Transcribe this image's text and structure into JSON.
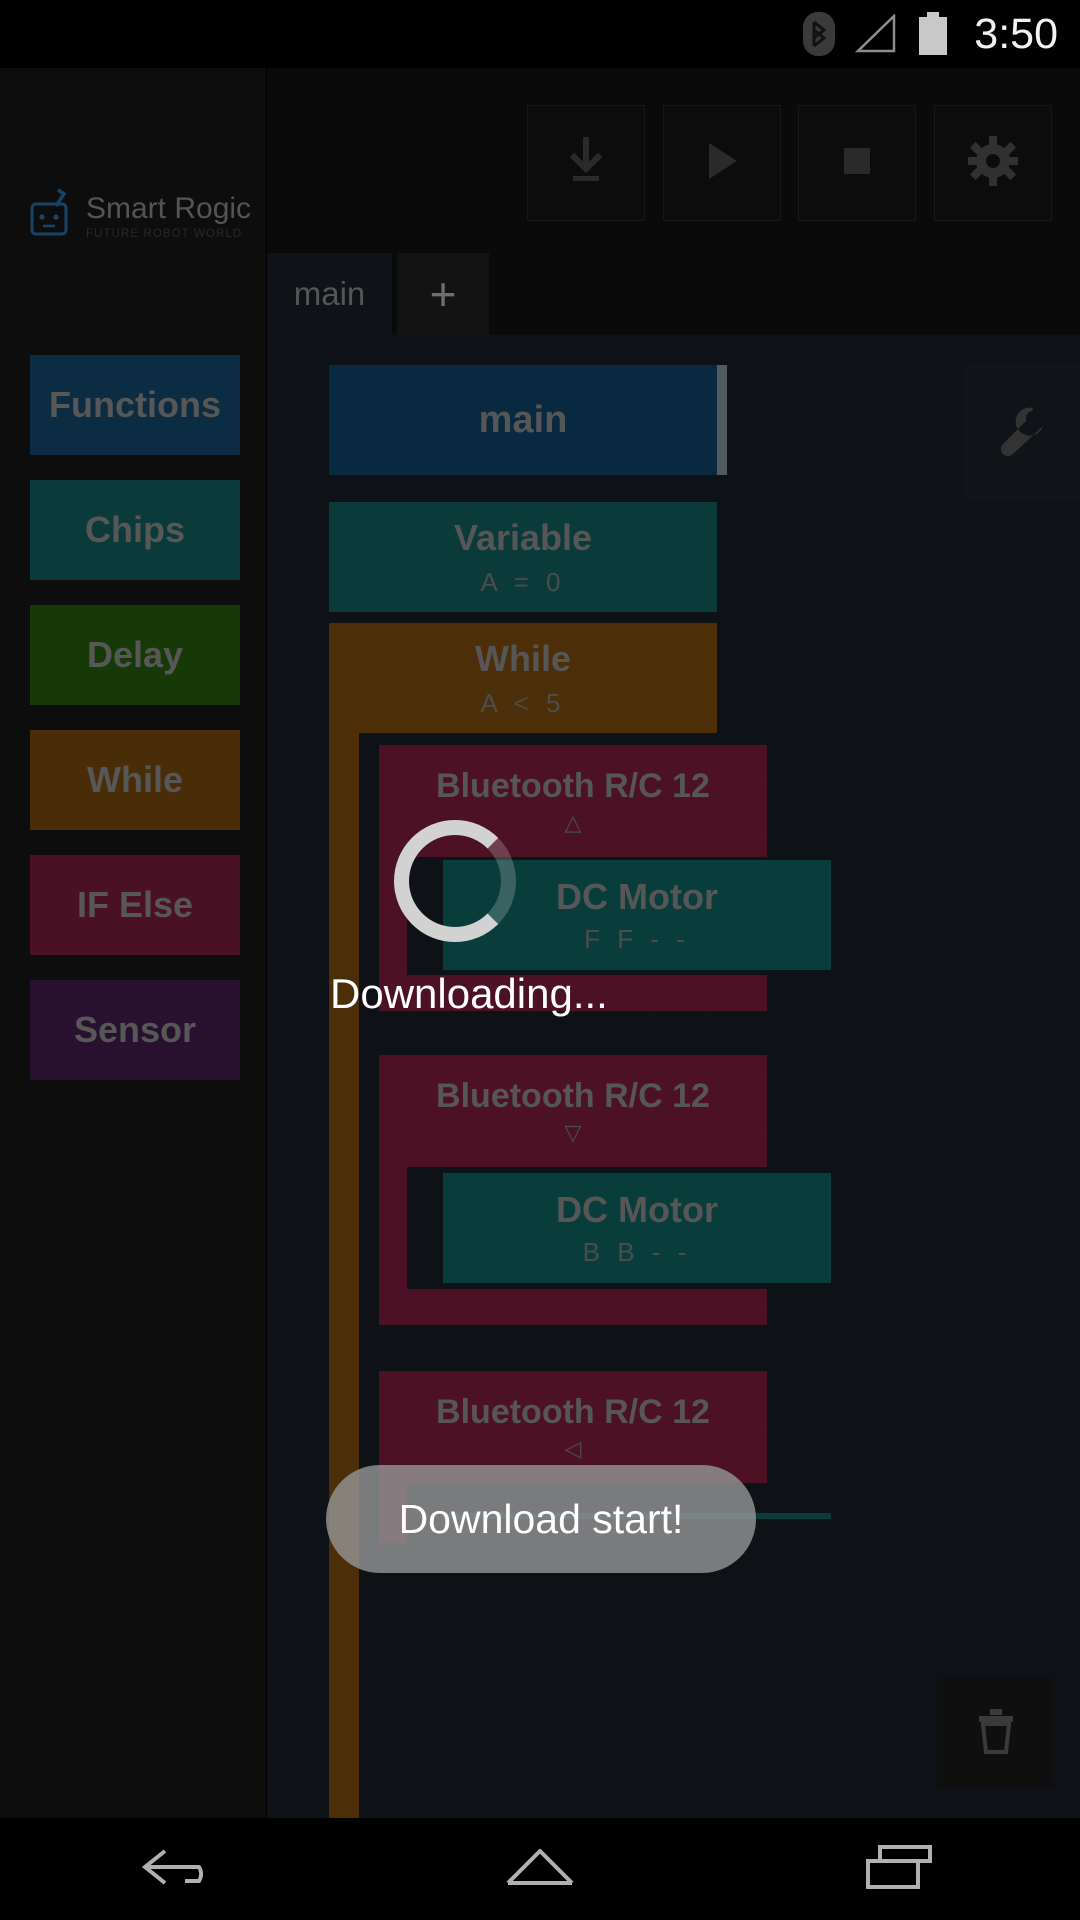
{
  "statusbar": {
    "time": "3:50",
    "icons": [
      "bluetooth-icon",
      "signal-icon",
      "battery-icon"
    ]
  },
  "sidebar": {
    "logo": {
      "name": "Smart Rogic",
      "tagline": "FUTURE ROBOT WORLD",
      "icon": "robot-head-icon"
    },
    "categories": [
      {
        "label": "Functions",
        "color": "#145078"
      },
      {
        "label": "Chips",
        "color": "#136c6b"
      },
      {
        "label": "Delay",
        "color": "#2b6910"
      },
      {
        "label": "While",
        "color": "#85500f"
      },
      {
        "label": "IF Else",
        "color": "#871f43"
      },
      {
        "label": "Sensor",
        "color": "#4a1f56"
      }
    ]
  },
  "toolbar": {
    "buttons": [
      {
        "name": "download-button",
        "icon": "download-icon"
      },
      {
        "name": "run-button",
        "icon": "play-icon"
      },
      {
        "name": "stop-button",
        "icon": "stop-icon"
      },
      {
        "name": "settings-button",
        "icon": "gear-icon"
      }
    ]
  },
  "tabs": {
    "items": [
      {
        "label": "main",
        "active": true
      }
    ],
    "add_label": "+"
  },
  "canvas": {
    "tools": {
      "wrench": "wrench-icon",
      "trash": "trash-icon"
    },
    "blocks": [
      {
        "title": "main",
        "sub": "",
        "color": "#0f4c75",
        "type": "function"
      },
      {
        "title": "Variable",
        "sub": "A = 0",
        "color": "#136b6a",
        "type": "variable"
      },
      {
        "title": "While",
        "sub": "A < 5",
        "color": "#8a5410",
        "type": "while"
      },
      {
        "title": "Bluetooth R/C 12",
        "sub": "△",
        "color": "#8c1f44",
        "type": "ifelse"
      },
      {
        "title": "DC Motor",
        "sub": "F  F  -  -",
        "color": "#116f6d",
        "type": "chip"
      },
      {
        "title": "Bluetooth R/C 12",
        "sub": "▽",
        "color": "#8c1f44",
        "type": "ifelse"
      },
      {
        "title": "DC Motor",
        "sub": "B  B  -  -",
        "color": "#116f6d",
        "type": "chip"
      },
      {
        "title": "Bluetooth R/C 12",
        "sub": "◁",
        "color": "#8c1f44",
        "type": "ifelse"
      }
    ]
  },
  "dialog": {
    "text": "Downloading...",
    "spinner": "loading-spinner"
  },
  "toast": {
    "text": "Download start!"
  },
  "navbar": {
    "buttons": [
      {
        "name": "back-button",
        "icon": "back-arrow-icon"
      },
      {
        "name": "home-button",
        "icon": "home-icon"
      },
      {
        "name": "recents-button",
        "icon": "recents-icon"
      }
    ]
  }
}
